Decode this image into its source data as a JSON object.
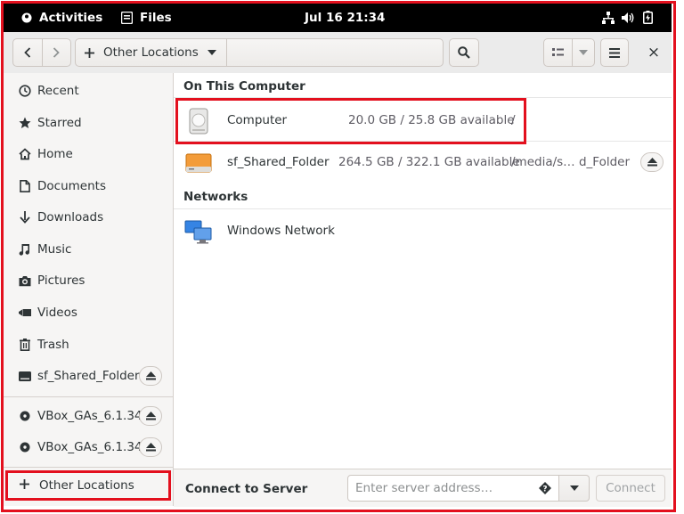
{
  "topbar": {
    "activities": "Activities",
    "app_name": "Files",
    "clock": "Jul 16  21:34",
    "tray_icons": [
      "network-icon",
      "volume-icon",
      "battery-icon"
    ]
  },
  "headerbar": {
    "location_label": "Other Locations",
    "close": "×"
  },
  "sidebar": {
    "items": [
      {
        "label": "Recent",
        "icon": "clock-icon"
      },
      {
        "label": "Starred",
        "icon": "star-icon"
      },
      {
        "label": "Home",
        "icon": "home-icon"
      },
      {
        "label": "Documents",
        "icon": "document-icon"
      },
      {
        "label": "Downloads",
        "icon": "download-icon"
      },
      {
        "label": "Music",
        "icon": "music-icon"
      },
      {
        "label": "Pictures",
        "icon": "camera-icon"
      },
      {
        "label": "Videos",
        "icon": "video-icon"
      },
      {
        "label": "Trash",
        "icon": "trash-icon"
      },
      {
        "label": "sf_Shared_Folder",
        "icon": "drive-icon"
      },
      {
        "label": "VBox_GAs_6.1.34",
        "icon": "disc-icon"
      },
      {
        "label": "VBox_GAs_6.1.34",
        "icon": "disc-icon"
      }
    ],
    "other_locations": "Other Locations"
  },
  "main": {
    "on_this_computer": "On This Computer",
    "networks": "Networks",
    "computer": {
      "name": "Computer",
      "size": "20.0 GB / 25.8 GB available",
      "path": "/"
    },
    "shared": {
      "name": "sf_Shared_Folder",
      "size": "264.5 GB / 322.1 GB available",
      "path": "/media/s… d_Folder"
    },
    "network": {
      "name": "Windows Network"
    }
  },
  "connect": {
    "label": "Connect to Server",
    "placeholder": "Enter server address…",
    "button": "Connect"
  },
  "colors": {
    "annotation_red": "#e3101e",
    "topbar_bg": "#000000",
    "sidebar_bg": "#f6f5f4",
    "drive_orange": "#f39c3a"
  }
}
